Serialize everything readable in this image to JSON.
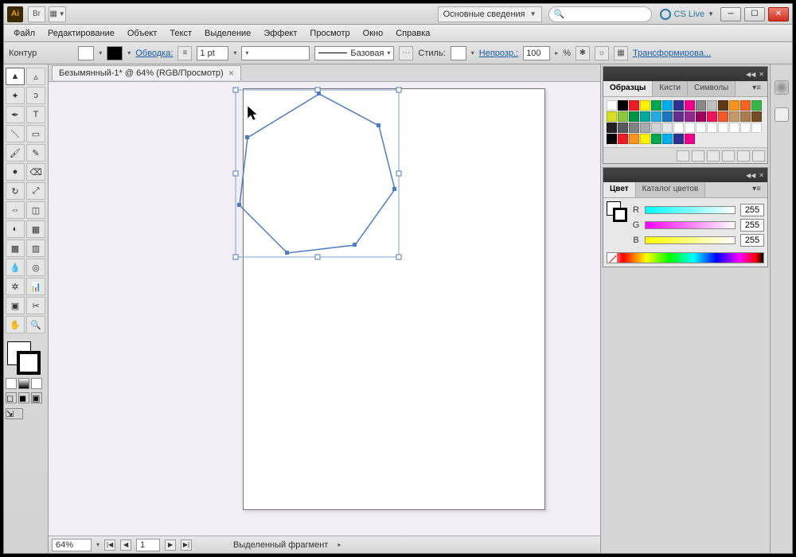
{
  "topbar": {
    "app_abbr": "Ai",
    "br_label": "Br",
    "workspace": "Основные сведения",
    "search_placeholder": "",
    "cslive": "CS Live"
  },
  "menu": {
    "file": "Файл",
    "edit": "Редактирование",
    "object": "Объект",
    "text": "Текст",
    "select": "Выделение",
    "effect": "Эффект",
    "view": "Просмотр",
    "window": "Окно",
    "help": "Справка"
  },
  "optbar": {
    "kontur": "Контур",
    "stroke_label": "Обводка:",
    "stroke_pt": "1 pt",
    "basic_label": "Базовая",
    "style_label": "Стиль:",
    "opacity_label": "Непрозр.:",
    "opacity_value": "100",
    "percent": "%",
    "transform": "Трансформирова..."
  },
  "doc": {
    "tab_title": "Безымянный-1* @ 64% (RGB/Просмотр)"
  },
  "status": {
    "zoom": "64%",
    "artboard_num": "1",
    "selection_label": "Выделенный фрагмент"
  },
  "panels": {
    "swatches_tabs": {
      "swatches": "Образцы",
      "brushes": "Кисти",
      "symbols": "Символы"
    },
    "color_tabs": {
      "color": "Цвет",
      "guide": "Каталог цветов"
    },
    "rgb": {
      "r_label": "R",
      "g_label": "G",
      "b_label": "B",
      "r": "255",
      "g": "255",
      "b": "255"
    }
  },
  "swatch_colors": [
    "#ffffff",
    "#000000",
    "#ed1c24",
    "#fff200",
    "#00a651",
    "#00aeef",
    "#2e3192",
    "#ec008c",
    "#898989",
    "#c0c0c0",
    "#603913",
    "#f7941d",
    "#f26522",
    "#39b54a",
    "#d7df23",
    "#8dc63f",
    "#009444",
    "#00a99d",
    "#27aae1",
    "#1c75bc",
    "#662d91",
    "#92278f",
    "#9e005d",
    "#ed145b",
    "#f1592a",
    "#c49a6c",
    "#a97c50",
    "#754c24",
    "#231f20",
    "#58595b",
    "#808285",
    "#a7a9ac",
    "#d1d3d4",
    "#e6e7e8",
    "#ffffff",
    "#ffffff",
    "#ffffff",
    "#ffffff",
    "#ffffff",
    "#ffffff",
    "#ffffff",
    "#ffffff",
    "#000000",
    "#ed1c24",
    "#f7941d",
    "#fff200",
    "#00a651",
    "#00aeef",
    "#2e3192",
    "#ec008c"
  ]
}
